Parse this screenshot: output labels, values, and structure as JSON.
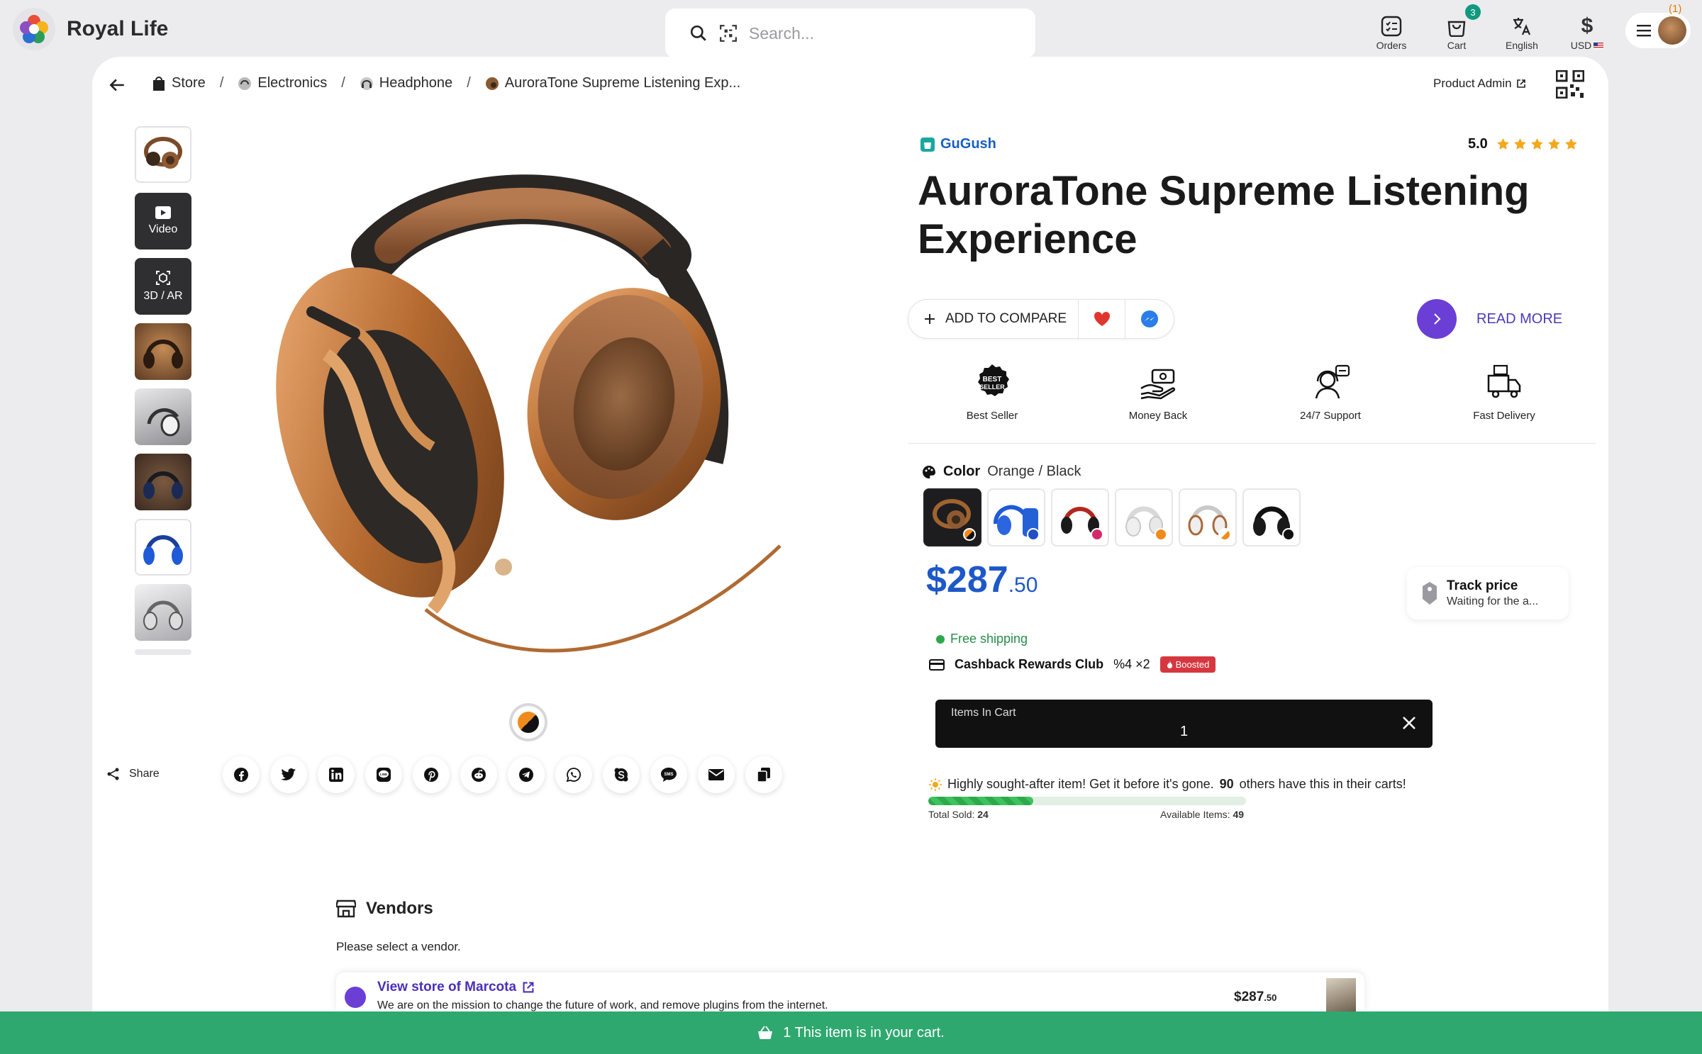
{
  "app": {
    "name": "Royal Life"
  },
  "search": {
    "placeholder": "Search..."
  },
  "topbar": {
    "orders": "Orders",
    "cart": "Cart",
    "cart_count": "3",
    "language": "English",
    "currency": "USD",
    "currency_symbol": "$",
    "account_badge": "1"
  },
  "breadcrumb": [
    {
      "label": "Store"
    },
    {
      "label": "Electronics"
    },
    {
      "label": "Headphone"
    },
    {
      "label": "AuroraTone Supreme Listening Exp..."
    }
  ],
  "admin": {
    "label": "Product Admin"
  },
  "gallery": {
    "video_label": "Video",
    "ar_label": "3D / AR"
  },
  "share": {
    "label": "Share",
    "networks": [
      "facebook",
      "twitter",
      "linkedin",
      "line",
      "pinterest",
      "reddit",
      "telegram",
      "whatsapp",
      "skype",
      "sms",
      "email",
      "copy"
    ]
  },
  "product": {
    "shop": "GuGush",
    "rating": "5.0",
    "stars": 5,
    "title": "AuroraTone Supreme Listening Experience",
    "compare_label": "ADD TO COMPARE",
    "read_more": "READ MORE",
    "features": [
      "Best Seller",
      "Money Back",
      "24/7 Support",
      "Fast Delivery"
    ],
    "color_label": "Color",
    "color_value": "Orange / Black",
    "price_main": "$287",
    "price_cents": ".50",
    "track_title": "Track price",
    "track_sub": "Waiting for the a...",
    "shipping": "Free shipping",
    "cashback": "Cashback Rewards Club",
    "cashback_rate": "%4 ×2",
    "boosted": "Boosted",
    "cart_label": "Items In Cart",
    "cart_qty": "1",
    "demand_pre": "Highly sought-after item! Get it before it's gone.",
    "demand_count": "90",
    "demand_post": "others have this in their carts!",
    "sold_label": "Total Sold:",
    "sold": "24",
    "available_label": "Available Items:",
    "available": "49",
    "sold_fraction": 0.33
  },
  "vendors": {
    "title": "Vendors",
    "prompt": "Please select a vendor.",
    "store_link": "View store of Marcota",
    "store_desc": "We are on the mission to change the future of work, and remove plugins from the internet.",
    "price_main": "$287",
    "price_cents": ".50"
  },
  "footer": {
    "text": "1 This item is in your cart."
  },
  "colors": {
    "accent": "#6b3fd6",
    "link": "#1a5fc2",
    "success": "#2ea86f",
    "star": "#f3a81c",
    "badge": "#109a7e",
    "boosted": "#d6373f"
  }
}
